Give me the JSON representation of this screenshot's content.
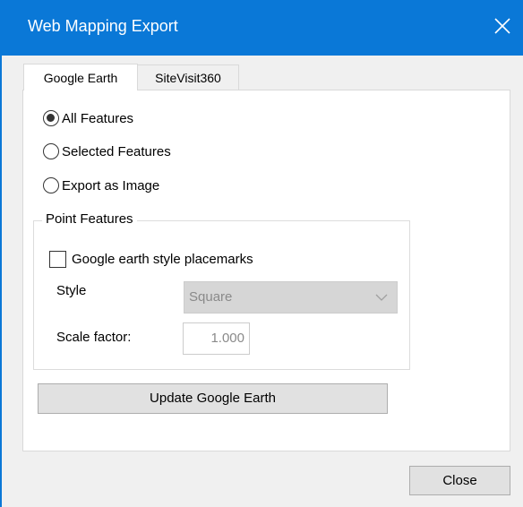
{
  "window": {
    "title": "Web Mapping Export",
    "close_glyph": "✕",
    "titlebar_color": "#0a78d7"
  },
  "tabs": [
    {
      "label": "Google Earth",
      "active": true
    },
    {
      "label": "SiteVisit360",
      "active": false
    }
  ],
  "export_options": [
    {
      "label": "All Features",
      "checked": true
    },
    {
      "label": "Selected Features",
      "checked": false
    },
    {
      "label": "Export as Image",
      "checked": false
    }
  ],
  "point_features": {
    "legend": "Point Features",
    "placemarks_checkbox": {
      "label": "Google earth style placemarks",
      "checked": false
    },
    "style_label": "Style",
    "style_value": "Square",
    "scale_label": "Scale factor:",
    "scale_value": "1.000"
  },
  "buttons": {
    "update": "Update Google Earth",
    "close": "Close"
  },
  "icons": {
    "window_close": "close-icon",
    "dropdown": "chevron-down-icon"
  }
}
